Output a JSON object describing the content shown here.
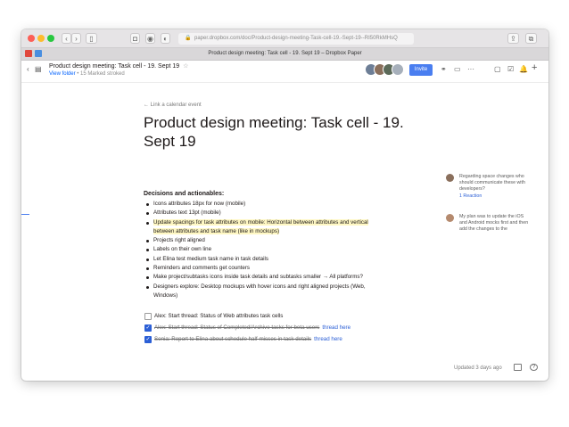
{
  "browser": {
    "url": "paper.dropbox.com/doc/Product-design-meeting-Task-cell-19.-Sept-19--RI50RkMHsQ",
    "tab_title": "Product design meeting: Task cell - 19. Sept 19 – Dropbox Paper"
  },
  "header": {
    "doc_title": "Product design meeting: Task cell - 19. Sept 19",
    "star": "☆",
    "view_folder": "View folder",
    "meta": "• 15 Marked stroked",
    "invite_label": "Invite",
    "icons": [
      "link-icon",
      "present-icon",
      "more-icon",
      "clipboard-icon",
      "checklist-icon",
      "bell-icon",
      "plus-icon"
    ]
  },
  "document": {
    "calendar_link": "← Link a calendar event",
    "title": "Product design meeting: Task cell - 19. Sept 19",
    "section_heading": "Decisions and actionables:",
    "bullets": [
      "Icons attributes 18px for now (mobile)",
      "Attributes text 13pt (mobile)",
      "Update spacings for task attributes on mobile: Horizontal between attributes and vertical",
      "between attributes and task name (like in mockups)",
      "Projects right aligned",
      "Labels on their own line",
      "Let Elina test medium task name in task details",
      "Reminders and comments get counters",
      "Make project/subtasks icons inside task details and subtasks smaller → All platforms?",
      "Designers explore: Desktop mockups with hover icons and right aligned projects (Web,",
      "Windows)"
    ],
    "tasks": [
      {
        "text": "Alex: Start thread: Status of Web attributes task cells",
        "done": false,
        "link": ""
      },
      {
        "text": "Alex: Start thread: Status of Completed/Archive tasks for beta users",
        "done": true,
        "link": "thread here"
      },
      {
        "text": "Sonia: Report to Elina about schedule half-misses in task details",
        "done": true,
        "link": "thread here"
      }
    ]
  },
  "comments": [
    {
      "text": "Regarding space changes who should communicate these with developers?",
      "link": "1 Reaction"
    },
    {
      "text": "My plan was to update the iOS and Android mocks first and then add the changes to the",
      "link": ""
    }
  ],
  "footer": {
    "updated": "Updated 3 days ago",
    "help": "?"
  },
  "colors": {
    "accent": "#4a7ef0",
    "link": "#2b5fd6",
    "highlight": "#fff8c4"
  }
}
